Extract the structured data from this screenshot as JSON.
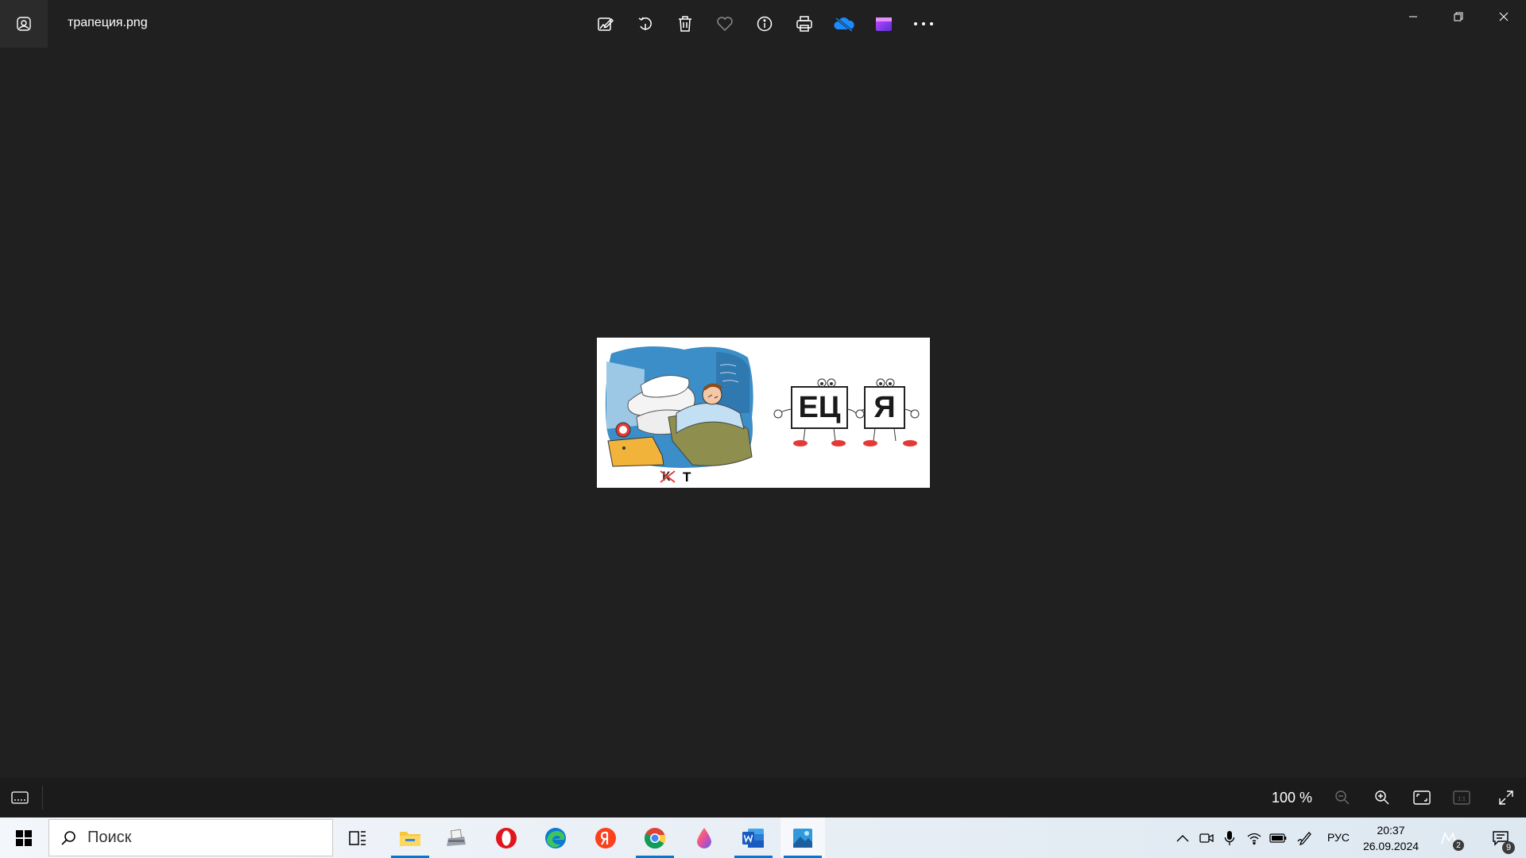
{
  "window": {
    "file_name": "трапеция.png",
    "toolbar": [
      {
        "name": "edit-image-icon",
        "label": "Edit"
      },
      {
        "name": "rotate-icon",
        "label": "Rotate"
      },
      {
        "name": "delete-icon",
        "label": "Delete"
      },
      {
        "name": "favorite-icon",
        "label": "Favorite"
      },
      {
        "name": "info-icon",
        "label": "Info"
      },
      {
        "name": "print-icon",
        "label": "Print"
      },
      {
        "name": "onedrive-icon",
        "label": "OneDrive"
      },
      {
        "name": "clipchamp-icon",
        "label": "Clipchamp"
      },
      {
        "name": "more-icon",
        "label": "More"
      }
    ],
    "controls": [
      "minimize-icon",
      "restore-icon",
      "close-icon"
    ]
  },
  "photo": {
    "rebus_left_letters": [
      "К",
      "Т"
    ],
    "rebus_right_letters": [
      "ЕЦ",
      "Я"
    ]
  },
  "bottombar": {
    "zoom_level": "100 %"
  },
  "taskbar": {
    "search_placeholder": "Поиск",
    "apps": [
      "task-view-icon",
      "file-explorer-icon",
      "fax-scan-icon",
      "opera-icon",
      "edge-icon",
      "yandex-icon",
      "chrome-icon",
      "drop-app-icon",
      "word-icon",
      "photos-icon"
    ],
    "language": "РУС",
    "time": "20:37",
    "date": "26.09.2024",
    "badge_small": "2",
    "notification_count": "9"
  }
}
